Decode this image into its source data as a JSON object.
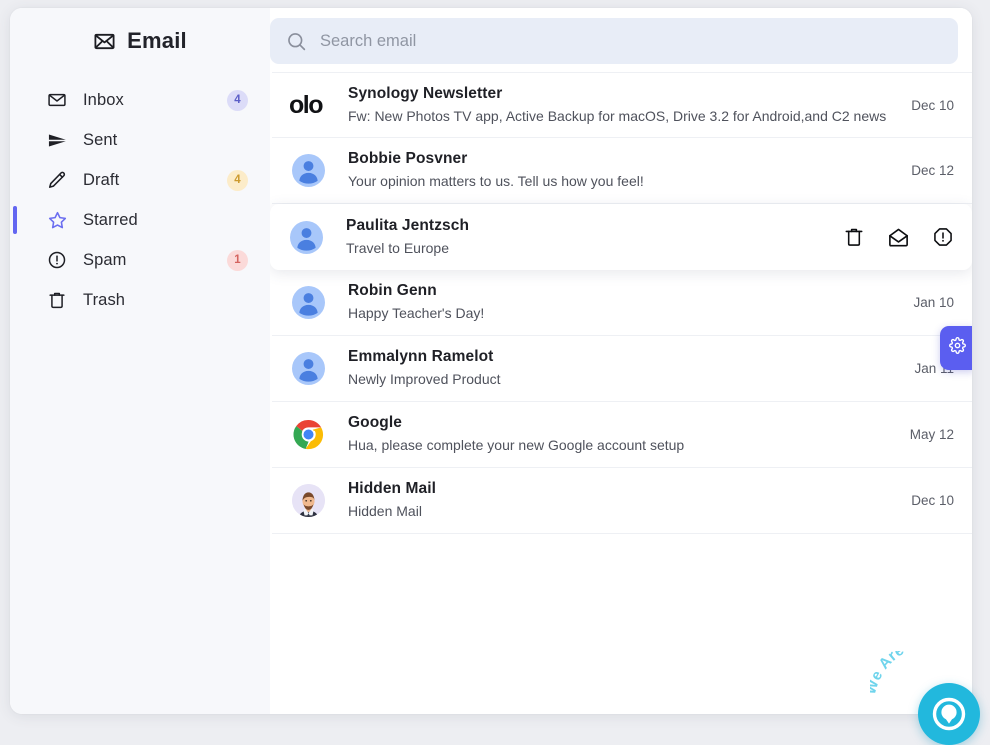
{
  "brand": {
    "title": "Email",
    "icon": "envelope-icon"
  },
  "sidebar": {
    "items": [
      {
        "label": "Inbox",
        "icon": "envelope-icon",
        "badge": "4",
        "badge_color": "#dcdcf8",
        "active": false
      },
      {
        "label": "Sent",
        "icon": "paper-plane-icon",
        "badge": "",
        "badge_color": "",
        "active": false
      },
      {
        "label": "Draft",
        "icon": "pencil-icon",
        "badge": "4",
        "badge_color": "#fcecc9",
        "active": false
      },
      {
        "label": "Starred",
        "icon": "star-icon",
        "badge": "",
        "badge_color": "",
        "active": true
      },
      {
        "label": "Spam",
        "icon": "alert-circle-icon",
        "badge": "1",
        "badge_color": "#fbdad9",
        "active": false
      },
      {
        "label": "Trash",
        "icon": "trash-icon",
        "badge": "",
        "badge_color": "",
        "active": false
      }
    ]
  },
  "search": {
    "placeholder": "Search email",
    "value": "",
    "icon": "search-icon"
  },
  "emails": [
    {
      "sender": "Synology Newsletter",
      "subject": "Fw: New Photos TV app, Active Backup for macOS, Drive 3.2 for Android,and C2 news",
      "date": "Dec 10",
      "avatar_type": "logo-text",
      "avatar_text": "olo",
      "hovered": false
    },
    {
      "sender": "Bobbie Posvner",
      "subject": "Your opinion matters to us. Tell us how you feel!",
      "date": "Dec 12",
      "avatar_type": "person",
      "avatar_text": "",
      "hovered": false
    },
    {
      "sender": "Paulita Jentzsch",
      "subject": "Travel to Europe",
      "date": "",
      "avatar_type": "person",
      "avatar_text": "",
      "hovered": true
    },
    {
      "sender": "Robin Genn",
      "subject": "Happy Teacher's Day!",
      "date": "Jan 10",
      "avatar_type": "person",
      "avatar_text": "",
      "hovered": false
    },
    {
      "sender": "Emmalynn Ramelot",
      "subject": "Newly Improved Product",
      "date": "Jan 11",
      "avatar_type": "person",
      "avatar_text": "",
      "hovered": false
    },
    {
      "sender": "Google",
      "subject": "Hua, please complete your new Google account setup",
      "date": "May 12",
      "avatar_type": "chrome-logo",
      "avatar_text": "",
      "hovered": false
    },
    {
      "sender": "Hidden Mail",
      "subject": "Hidden Mail",
      "date": "Dec 10",
      "avatar_type": "man-avatar",
      "avatar_text": "",
      "hovered": false
    }
  ],
  "row_actions": [
    {
      "name": "delete-action",
      "icon": "trash-icon"
    },
    {
      "name": "mark-read-action",
      "icon": "open-envelope-icon"
    },
    {
      "name": "report-spam-action",
      "icon": "alert-octagon-icon"
    }
  ],
  "settings_tab": {
    "icon": "gear-icon",
    "color": "#5b5ef0"
  },
  "chat_widget": {
    "label": "We Are Here!",
    "icon": "chat-bubble-icon",
    "color": "#22b8dd"
  }
}
